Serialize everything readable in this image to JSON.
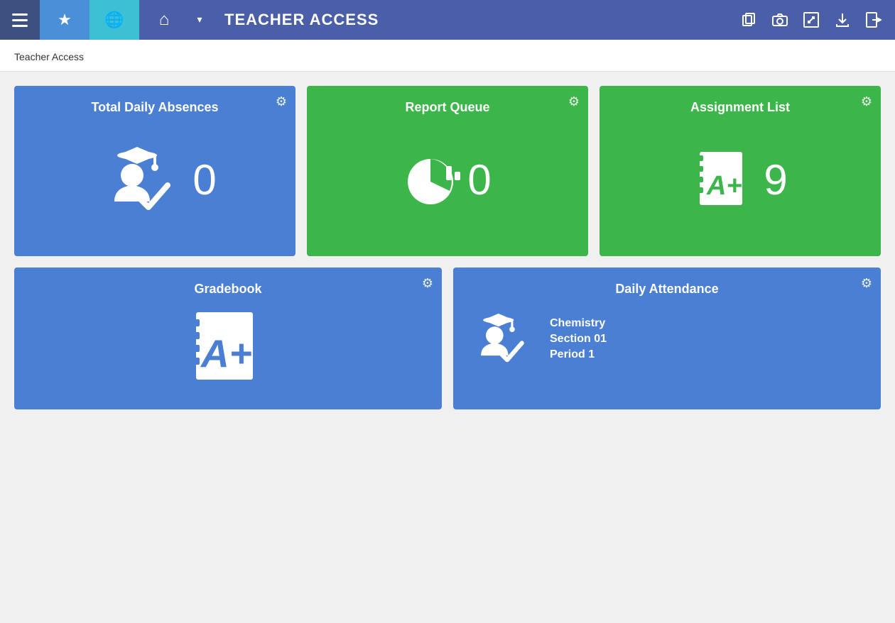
{
  "header": {
    "title": "TEACHER ACCESS",
    "menu_btn_label": "Menu",
    "tabs": [
      {
        "id": "star",
        "label": "Favorites"
      },
      {
        "id": "globe",
        "label": "World"
      },
      {
        "id": "home",
        "label": "Home"
      }
    ],
    "actions": [
      {
        "id": "copy",
        "label": "Copy"
      },
      {
        "id": "camera",
        "label": "Screenshot"
      },
      {
        "id": "resize",
        "label": "Resize"
      },
      {
        "id": "download",
        "label": "Download"
      },
      {
        "id": "logout",
        "label": "Logout"
      }
    ]
  },
  "breadcrumb": "Teacher Access",
  "tiles": {
    "row1": [
      {
        "id": "total-daily-absences",
        "title": "Total Daily Absences",
        "color": "blue",
        "count": "0",
        "icon": "student-check"
      },
      {
        "id": "report-queue",
        "title": "Report Queue",
        "color": "green",
        "count": "0",
        "icon": "pie-chart"
      },
      {
        "id": "assignment-list",
        "title": "Assignment List",
        "color": "green",
        "count": "9",
        "icon": "gradebook-aplus"
      }
    ],
    "row2": [
      {
        "id": "gradebook",
        "title": "Gradebook",
        "color": "blue",
        "icon": "gradebook-big"
      },
      {
        "id": "daily-attendance",
        "title": "Daily Attendance",
        "color": "blue",
        "icon": "student-check",
        "info": {
          "subject": "Chemistry",
          "section": "Section 01",
          "period": "Period 1"
        }
      }
    ]
  },
  "gear_label": "Settings"
}
